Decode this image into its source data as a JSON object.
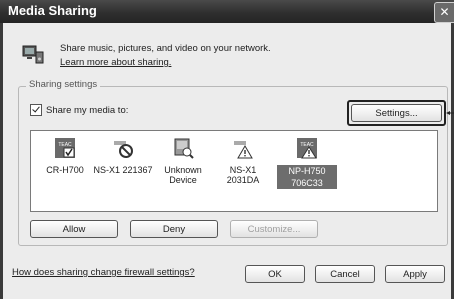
{
  "window": {
    "title": "Media Sharing",
    "close_glyph": "✕"
  },
  "header": {
    "description": "Share music, pictures, and video on your network.",
    "learn_more": "Learn more about sharing."
  },
  "sharing": {
    "group_label": "Sharing settings",
    "share_checkbox_label": "Share my media to:",
    "settings_button": "Settings...",
    "devices": [
      {
        "label_line1": "CR-H700",
        "label_line2": "",
        "icon": "teac-check-icon"
      },
      {
        "label_line1": "NS-X1 221367",
        "label_line2": "",
        "icon": "blocked-device-icon"
      },
      {
        "label_line1": "Unknown",
        "label_line2": "Device",
        "icon": "unknown-device-icon"
      },
      {
        "label_line1": "NS-X1",
        "label_line2": "2031DA",
        "icon": "warning-device-icon"
      },
      {
        "label_line1": "NP-H750",
        "label_line2": "706C33",
        "icon": "teac-warning-icon"
      }
    ],
    "allow_button": "Allow",
    "deny_button": "Deny",
    "customize_button": "Customize..."
  },
  "footer": {
    "firewall_link": "How does sharing change firewall settings?",
    "ok_button": "OK",
    "cancel_button": "Cancel",
    "apply_button": "Apply"
  }
}
